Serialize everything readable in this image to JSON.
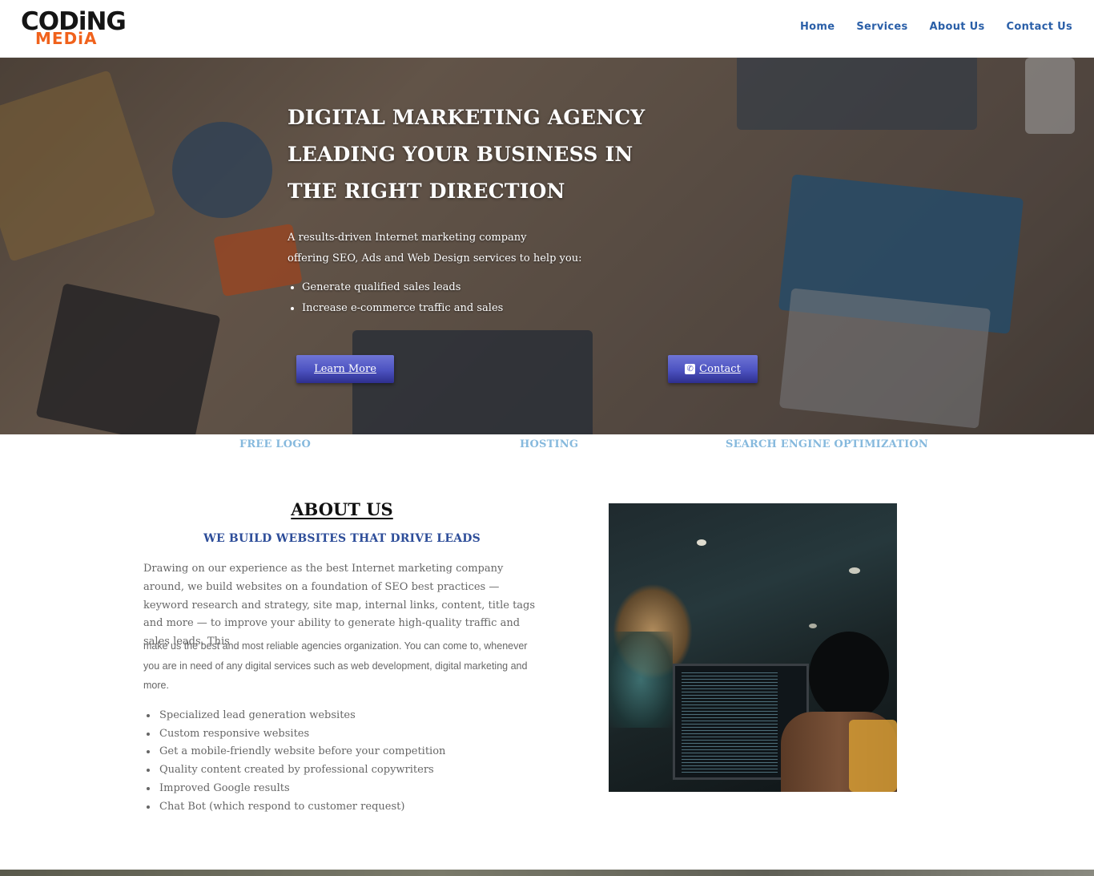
{
  "logo": {
    "line1": "CODiNG",
    "line2": "MEDiA"
  },
  "nav": {
    "items": [
      {
        "label": "Home"
      },
      {
        "label": "Services"
      },
      {
        "label": "About Us"
      },
      {
        "label": "Contact Us"
      }
    ]
  },
  "hero": {
    "title_lines": [
      "DIGITAL MARKETING AGENCY",
      "LEADING YOUR BUSINESS IN",
      "THE RIGHT DIRECTION"
    ],
    "text_lines": [
      "A results-driven Internet marketing company",
      "offering SEO, Ads and Web Design services to help you:"
    ],
    "bullets": [
      "Generate qualified sales leads",
      "Increase e-commerce traffic and sales"
    ],
    "learn_more_label": "Learn More",
    "contact_label": "Contact"
  },
  "features": [
    "FREE LOGO",
    "HOSTING",
    "SEARCH ENGINE OPTIMIZATION"
  ],
  "about": {
    "title": "ABOUT US",
    "subtitle": "WE BUILD WEBSITES THAT DRIVE LEADS",
    "para1": "Drawing on our experience as the best Internet marketing company around, we build websites on a foundation of SEO best practices — keyword research and strategy, site map, internal links, content, title tags and more — to improve your ability to generate high-quality traffic and sales leads. This",
    "para2": "make us the best  and most reliable agencies organization. You can come to, whenever you are in need of any digital services such as web development, digital marketing and more.",
    "bullets": [
      "Specialized lead generation websites",
      "Custom responsive websites",
      "Get a mobile-friendly website before your competition",
      "Quality content created by professional copywriters",
      "Improved Google results",
      "Chat Bot (which respond to customer request)"
    ]
  },
  "colors": {
    "nav": "#2a5fa8",
    "accent_orange": "#f0621c",
    "feature": "#86b9dd",
    "subtitle": "#2d4d99",
    "button": "#4c52c0"
  }
}
